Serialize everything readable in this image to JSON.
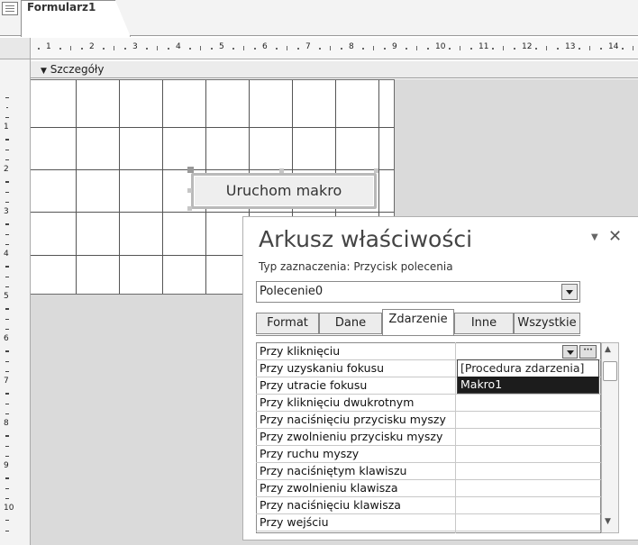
{
  "window": {
    "tab_title": "Formularz1"
  },
  "ruler": {
    "marks": [
      "1",
      "2",
      "3",
      "4",
      "5",
      "6",
      "7",
      "8",
      "9",
      "10",
      "11",
      "12",
      "13",
      "14"
    ]
  },
  "vruler": {
    "marks": [
      "1",
      "2",
      "3",
      "4",
      "5",
      "6",
      "7",
      "8",
      "9",
      "10"
    ]
  },
  "section": {
    "label": "Szczegóły"
  },
  "design": {
    "button_label": "Uruchom makro"
  },
  "property_sheet": {
    "title": "Arkusz właściwości",
    "selection_type": "Typ zaznaczenia:  Przycisk polecenia",
    "object_selected": "Polecenie0",
    "tabs": [
      {
        "label": "Format",
        "active": false
      },
      {
        "label": "Dane",
        "active": false
      },
      {
        "label": "Zdarzenie",
        "active": true
      },
      {
        "label": "Inne",
        "active": false
      },
      {
        "label": "Wszystkie",
        "active": false
      }
    ],
    "properties": [
      "Przy kliknięciu",
      "Przy uzyskaniu fokusu",
      "Przy utracie fokusu",
      "Przy kliknięciu dwukrotnym",
      "Przy naciśnięciu przycisku myszy",
      "Przy zwolnieniu przycisku myszy",
      "Przy ruchu myszy",
      "Przy naciśniętym klawiszu",
      "Przy zwolnieniu klawisza",
      "Przy naciśnięciu klawisza",
      "Przy wejściu"
    ],
    "dropdown_options": [
      "[Procedura zdarzenia]",
      "Makro1"
    ],
    "dropdown_selected": "Makro1",
    "ellipsis_label": "···"
  },
  "icons": {
    "section_arrow": "down-arrow-icon",
    "close": "close-icon",
    "panel_menu": "dropdown-triangle-icon",
    "scroll_up": "scroll-up-icon",
    "scroll_down": "scroll-down-icon"
  }
}
